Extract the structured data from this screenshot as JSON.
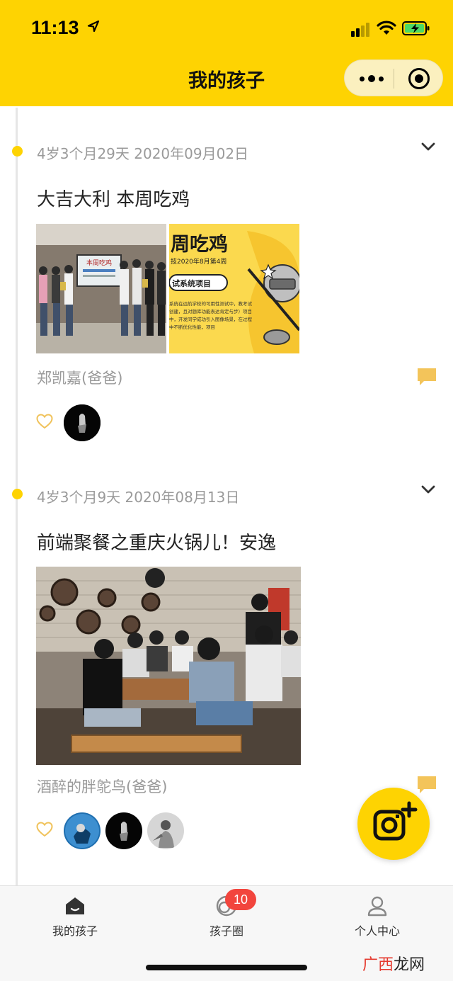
{
  "status_bar": {
    "time": "11:13"
  },
  "header": {
    "title": "我的孩子"
  },
  "posts": [
    {
      "meta": "4岁3个月29天 2020年09月02日",
      "title": "大吉大利 本周吃鸡",
      "author": "郑凯嘉(爸爸)",
      "photos": [
        {
          "kind": "team-photo",
          "screen_text": "本周吃鸡"
        },
        {
          "kind": "poster",
          "heading": "周吃鸡",
          "subheading": "技2020年8月第4周",
          "tag": "试系统项目",
          "body": "系统在远航学校的可用性测试中，教考试创建，且对题库功能表达肯定与步）项目中，开发同学成功引入图像场景，在过程中不断优化性能，项目"
        }
      ]
    },
    {
      "meta": "4岁3个月9天 2020年08月13日",
      "title": "前端聚餐之重庆火锅儿！安逸",
      "author": "酒醉的胖鸵鸟(爸爸)"
    }
  ],
  "tabbar": {
    "items": [
      {
        "label": "我的孩子",
        "icon": "home-icon"
      },
      {
        "label": "孩子圈",
        "icon": "circle-icon",
        "badge": "10"
      },
      {
        "label": "个人中心",
        "icon": "person-icon"
      }
    ]
  },
  "watermark": {
    "part1": "广西",
    "part2": "龙网"
  },
  "colors": {
    "brand_yellow": "#fed302",
    "badge_red": "#f2453d",
    "timeline_gray": "#e6e6e6",
    "meta_gray": "#9a9a9a"
  }
}
